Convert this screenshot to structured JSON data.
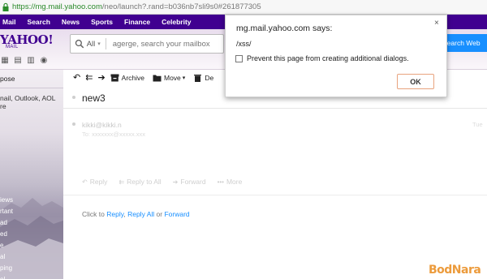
{
  "browser": {
    "url_main": "https://mg.mail.yahoo.com",
    "url_rest": "/neo/launch?.rand=b036nb7sli9s0#261877305"
  },
  "yahoo_nav": [
    "Mail",
    "Search",
    "News",
    "Sports",
    "Finance",
    "Celebrity"
  ],
  "header": {
    "logo": "YAHOO!",
    "logo_sub": "MAIL",
    "search_scope": "All",
    "search_placeholder": "agerge, search your mailbox",
    "search_web": "Search Web"
  },
  "sidebar": {
    "compose": "pose",
    "promo_line1": "nail, Outlook, AOL",
    "promo_line2": "re",
    "items": [
      "iews",
      "rtant",
      "ad",
      "ed",
      "e",
      "al",
      "ping",
      "el"
    ]
  },
  "toolbar": {
    "archive": "Archive",
    "move": "Move",
    "delete": "De"
  },
  "message": {
    "subject": "new3",
    "sender": "kikki@kikki.n",
    "to_line": "To: xxxxxxx@xxxxx.xxx",
    "date": "Tue",
    "actions": [
      "Reply",
      "Reply to All",
      "Forward",
      "More"
    ],
    "quick_reply_prefix": "Click to",
    "quick_reply_reply": "Reply",
    "quick_reply_reply_all": "Reply All",
    "quick_reply_or": "or",
    "quick_reply_forward": "Forward"
  },
  "dialog": {
    "title": "mg.mail.yahoo.com says:",
    "message": "/xss/",
    "checkbox_label": "Prevent this page from creating additional dialogs.",
    "ok": "OK",
    "close": "×"
  },
  "watermark": "BodNara",
  "colors": {
    "yahoo_purple": "#400090",
    "search_web_blue": "#188fff",
    "url_green": "#2a8a2a",
    "ok_border": "#e8a37e"
  }
}
